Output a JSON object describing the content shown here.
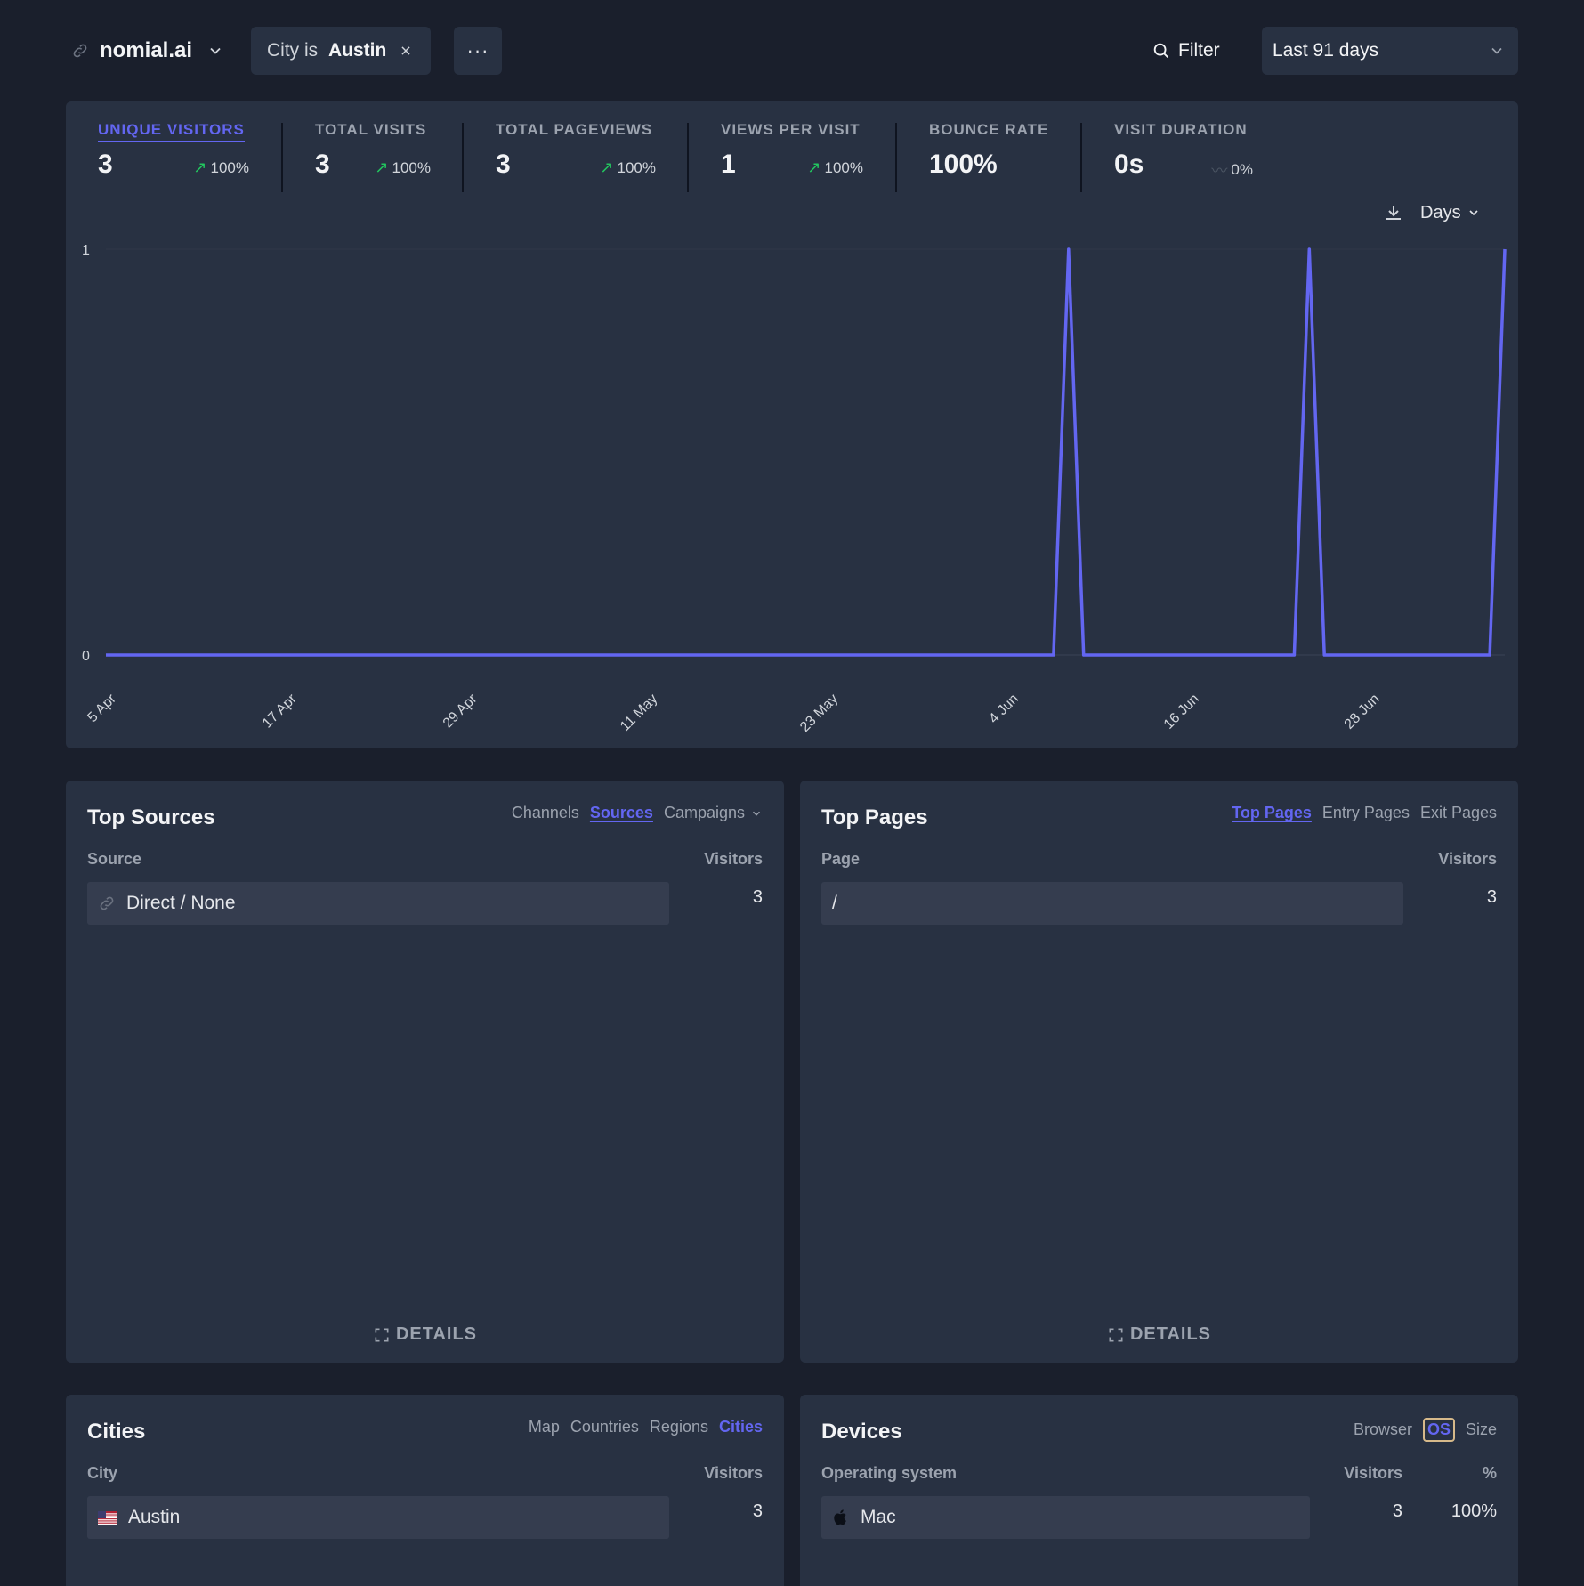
{
  "header": {
    "site_name": "nomial.ai",
    "filter_prefix": "City is ",
    "filter_value": "Austin",
    "filter_remove": "✕",
    "more": "···",
    "filter_button": "Filter",
    "period": "Last 91 days"
  },
  "stats": [
    {
      "label": "Unique visitors",
      "value": "3",
      "change": "100%",
      "trend": "up",
      "active": true
    },
    {
      "label": "Total visits",
      "value": "3",
      "change": "100%",
      "trend": "up"
    },
    {
      "label": "Total pageviews",
      "value": "3",
      "change": "100%",
      "trend": "up"
    },
    {
      "label": "Views per visit",
      "value": "1",
      "change": "100%",
      "trend": "up"
    },
    {
      "label": "Bounce rate",
      "value": "100%",
      "change": "",
      "trend": "none"
    },
    {
      "label": "Visit duration",
      "value": "0s",
      "change": "0%",
      "trend": "flat"
    }
  ],
  "chart_controls": {
    "interval": "Days"
  },
  "chart_data": {
    "type": "line",
    "series": [
      {
        "values": [
          0,
          0,
          0,
          0,
          0,
          0,
          0,
          0,
          0,
          0,
          0,
          0,
          0,
          0,
          0,
          0,
          0,
          0,
          0,
          0,
          0,
          0,
          0,
          0,
          0,
          0,
          0,
          0,
          0,
          0,
          0,
          0,
          0,
          0,
          0,
          0,
          0,
          0,
          0,
          0,
          0,
          0,
          0,
          0,
          0,
          0,
          0,
          0,
          0,
          0,
          0,
          0,
          0,
          0,
          0,
          0,
          0,
          0,
          0,
          0,
          0,
          0,
          0,
          0,
          1,
          0,
          0,
          0,
          0,
          0,
          0,
          0,
          0,
          0,
          0,
          0,
          0,
          0,
          0,
          0,
          1,
          0,
          0,
          0,
          0,
          0,
          0,
          0,
          0,
          0,
          0,
          0,
          0,
          1
        ]
      }
    ],
    "x_start": "5 Apr",
    "xticks": [
      "5 Apr",
      "17 Apr",
      "29 Apr",
      "11 May",
      "23 May",
      "4 Jun",
      "16 Jun",
      "28 Jun"
    ],
    "yticks": [
      "0",
      "1"
    ],
    "ylim": [
      0,
      1
    ],
    "color": "#6366f1"
  },
  "top_sources": {
    "title": "Top Sources",
    "tabs": [
      "Channels",
      "Sources",
      "Campaigns"
    ],
    "active_tab": "Sources",
    "col_left": "Source",
    "col_right": "Visitors",
    "rows": [
      {
        "label": "Direct / None",
        "visitors": "3"
      }
    ],
    "details": "DETAILS"
  },
  "top_pages": {
    "title": "Top Pages",
    "tabs": [
      "Top Pages",
      "Entry Pages",
      "Exit Pages"
    ],
    "active_tab": "Top Pages",
    "col_left": "Page",
    "col_right": "Visitors",
    "rows": [
      {
        "label": "/",
        "visitors": "3"
      }
    ],
    "details": "DETAILS"
  },
  "cities": {
    "title": "Cities",
    "tabs": [
      "Map",
      "Countries",
      "Regions",
      "Cities"
    ],
    "active_tab": "Cities",
    "col_left": "City",
    "col_right": "Visitors",
    "rows": [
      {
        "label": "Austin",
        "visitors": "3",
        "flag": "us-flag-icon"
      }
    ]
  },
  "devices": {
    "title": "Devices",
    "tabs": [
      "Browser",
      "OS",
      "Size"
    ],
    "active_tab": "OS",
    "col_left": "Operating system",
    "col_mid": "Visitors",
    "col_right": "%",
    "rows": [
      {
        "label": "Mac",
        "visitors": "3",
        "percent": "100%",
        "icon": "apple-icon"
      }
    ]
  },
  "colors": {
    "background": "#1a1f2c",
    "card": "#283142",
    "accent": "#6366f1",
    "trend_up": "#22c55e"
  }
}
